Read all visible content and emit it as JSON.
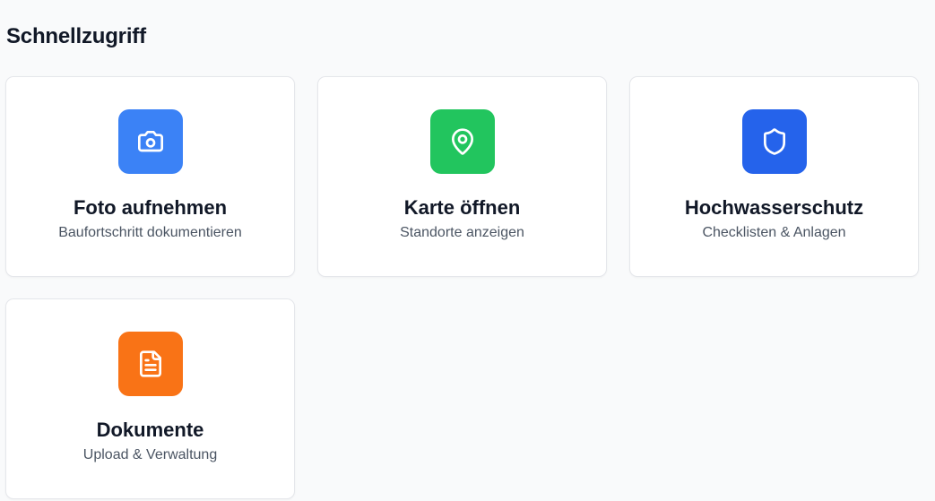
{
  "section": {
    "title": "Schnellzugriff"
  },
  "cards": [
    {
      "title": "Foto aufnehmen",
      "subtitle": "Baufortschritt dokumentieren",
      "icon": "camera-icon",
      "color": "#3b82f6"
    },
    {
      "title": "Karte öffnen",
      "subtitle": "Standorte anzeigen",
      "icon": "map-pin-icon",
      "color": "#22c55e"
    },
    {
      "title": "Hochwasserschutz",
      "subtitle": "Checklisten & Anlagen",
      "icon": "shield-icon",
      "color": "#2563eb"
    },
    {
      "title": "Dokumente",
      "subtitle": "Upload & Verwaltung",
      "icon": "document-icon",
      "color": "#f97316"
    }
  ]
}
